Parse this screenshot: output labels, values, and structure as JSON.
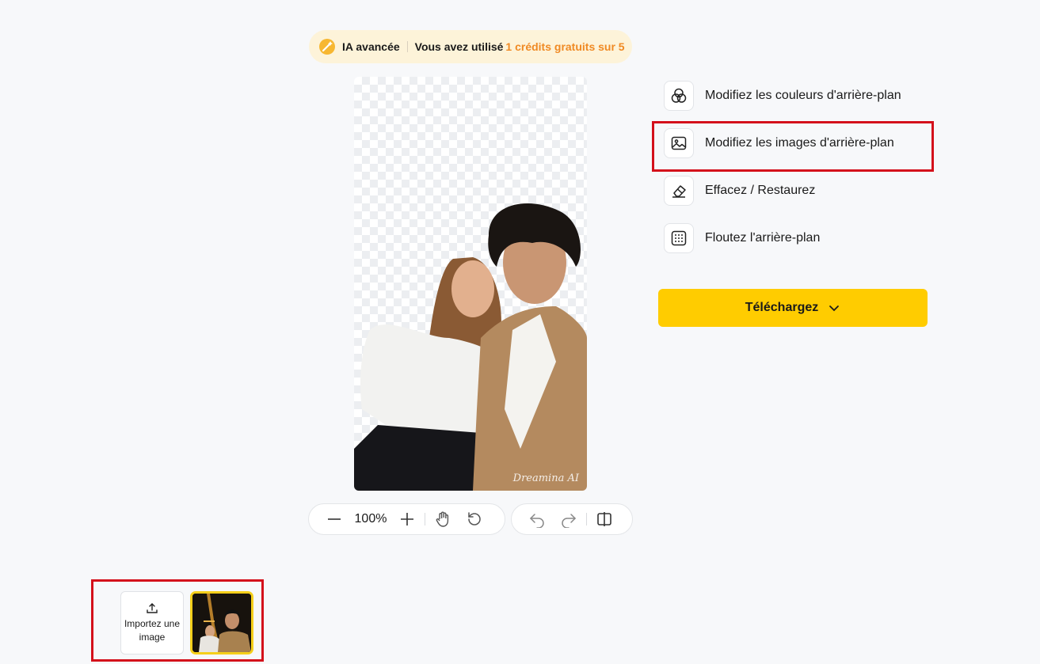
{
  "badge": {
    "ai_label": "IA avancée",
    "usage_text": "Vous avez utilisé",
    "credits_text": "1 crédits gratuits sur 5",
    "accent": "#f08a24"
  },
  "preview": {
    "watermark": "Dreamina AI"
  },
  "zoom_toolbar": {
    "zoom_value": "100%"
  },
  "options": [
    {
      "label": "Modifiez les couleurs d'arrière-plan",
      "icon": "color-circles-icon"
    },
    {
      "label": "Modifiez les images d'arrière-plan",
      "icon": "image-icon"
    },
    {
      "label": "Effacez / Restaurez",
      "icon": "eraser-icon"
    },
    {
      "label": "Floutez l'arrière-plan",
      "icon": "blur-grid-icon"
    }
  ],
  "download": {
    "label": "Téléchargez",
    "color": "#ffcc00"
  },
  "upload": {
    "label": "Importez une image"
  },
  "highlight_color": "#d4101b"
}
